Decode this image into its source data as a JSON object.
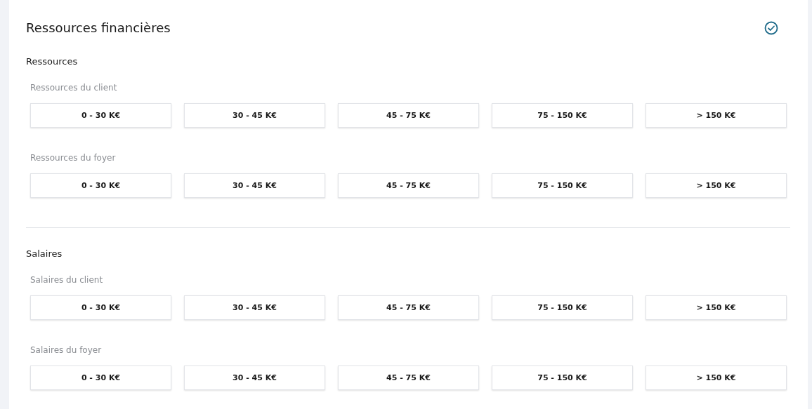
{
  "title": "Ressources financières",
  "complete": true,
  "sections": [
    {
      "title": "Ressources",
      "groups": [
        {
          "label": "Ressources du client",
          "options": [
            {
              "label": "0 - 30 K€",
              "selected": false
            },
            {
              "label": "30 - 45 K€",
              "selected": false
            },
            {
              "label": "45 - 75 K€",
              "selected": false
            },
            {
              "label": "75 - 150 K€",
              "selected": false
            },
            {
              "label": "> 150 K€",
              "selected": false
            }
          ]
        },
        {
          "label": "Ressources du foyer",
          "options": [
            {
              "label": "0 - 30 K€",
              "selected": false
            },
            {
              "label": "30 - 45 K€",
              "selected": false
            },
            {
              "label": "45 - 75 K€",
              "selected": false
            },
            {
              "label": "75 - 150 K€",
              "selected": false
            },
            {
              "label": "> 150 K€",
              "selected": false
            }
          ]
        }
      ]
    },
    {
      "title": "Salaires",
      "groups": [
        {
          "label": "Salaires du client",
          "options": [
            {
              "label": "0 - 30 K€",
              "selected": false
            },
            {
              "label": "30 - 45 K€",
              "selected": false
            },
            {
              "label": "45 - 75 K€",
              "selected": false
            },
            {
              "label": "75 - 150 K€",
              "selected": false
            },
            {
              "label": "> 150 K€",
              "selected": false
            }
          ]
        },
        {
          "label": "Salaires du foyer",
          "options": [
            {
              "label": "0 - 30 K€",
              "selected": false
            },
            {
              "label": "30 - 45 K€",
              "selected": false
            },
            {
              "label": "45 - 75 K€",
              "selected": false
            },
            {
              "label": "75 - 150 K€",
              "selected": false
            },
            {
              "label": "> 150 K€",
              "selected": false
            }
          ]
        }
      ]
    }
  ]
}
